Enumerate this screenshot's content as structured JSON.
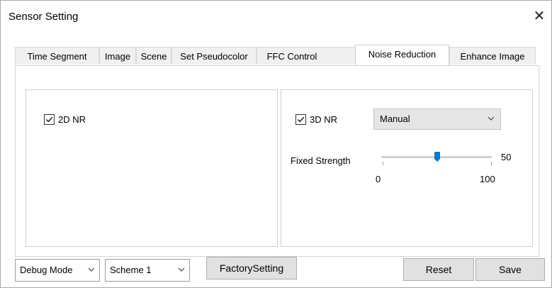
{
  "window": {
    "title": "Sensor Setting",
    "close_glyph": "✕"
  },
  "tabs": [
    {
      "label": "Time Segment"
    },
    {
      "label": "Image"
    },
    {
      "label": "Scene"
    },
    {
      "label": "Set Pseudocolor"
    },
    {
      "label": "FFC Control"
    },
    {
      "label": "Noise Reduction",
      "active": true
    },
    {
      "label": "Enhance Image"
    }
  ],
  "nr2d": {
    "label": "2D NR",
    "checked": true
  },
  "nr3d": {
    "label": "3D NR",
    "checked": true,
    "mode": "Manual",
    "fixed_strength": {
      "label": "Fixed Strength",
      "value": 50,
      "value_text": "50",
      "min": 0,
      "max": 100,
      "min_text": "0",
      "max_text": "100"
    }
  },
  "footer": {
    "mode_select": "Debug Mode",
    "scheme_select": "Scheme 1",
    "factory_button": "FactorySetting",
    "reset_button": "Reset",
    "save_button": "Save"
  },
  "colors": {
    "accent": "#0078d7",
    "button_bg": "#e1e1e1",
    "combo_bg": "#e5e5e5"
  }
}
